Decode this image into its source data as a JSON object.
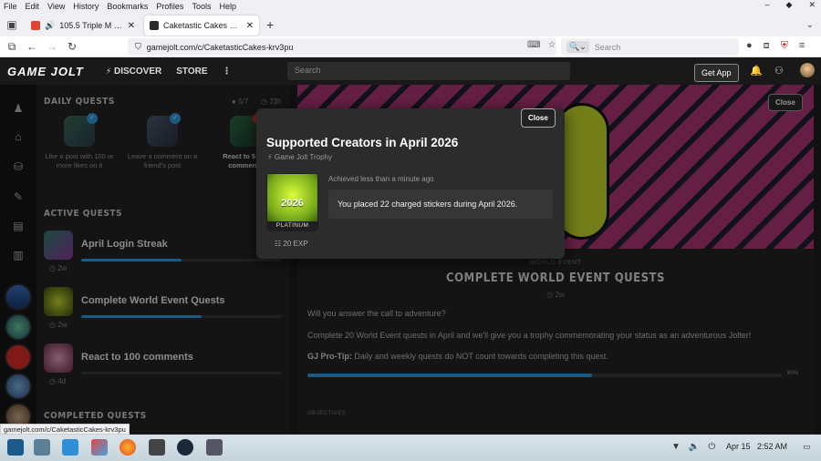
{
  "menu": [
    "File",
    "Edit",
    "View",
    "History",
    "Bookmarks",
    "Profiles",
    "Tools",
    "Help"
  ],
  "window_controls": [
    "–",
    "◆",
    "✕"
  ],
  "tabs": [
    {
      "title": "105.5 Triple M - The Sc",
      "close": "✕"
    },
    {
      "title": "Caketastic Cakes Commu",
      "close": "✕"
    }
  ],
  "new_tab": "+",
  "address": {
    "url": "gamejolt.com/c/CaketasticCakes-krv3pu"
  },
  "search": {
    "placeholder": "Search"
  },
  "site": {
    "logo": "GAME JOLT",
    "nav": [
      "DISCOVER",
      "STORE"
    ],
    "search_placeholder": "Search",
    "get_app": "Get App"
  },
  "quests": {
    "daily_title": "DAILY QUESTS",
    "daily_progress": "5/7",
    "daily_timer": "23h",
    "daily": [
      {
        "label": "Like a post with 100 or more likes on it"
      },
      {
        "label": "Leave a comment on a friend's post"
      },
      {
        "label": "React to 5 diff comments"
      }
    ],
    "active_title": "ACTIVE QUESTS",
    "active": [
      {
        "name": "April Login Streak",
        "time": "2w",
        "progress": 0.5
      },
      {
        "name": "Complete World Event Quests",
        "time": "2w",
        "progress": 0.6
      },
      {
        "name": "React to 100 comments",
        "time": "4d",
        "progress": 0.0
      }
    ],
    "completed_title": "COMPLETED QUESTS"
  },
  "world_event": {
    "kicker": "WORLD EVENT",
    "title": "COMPLETE WORLD EVENT QUESTS",
    "time": "2w",
    "q": "Will you answer the call to adventure?",
    "body": "Complete 20 World Event quests in April and we'll give you a trophy commemorating your status as an adventurous Jolter!",
    "tip_label": "GJ Pro-Tip:",
    "tip": "Daily and weekly quests do NOT count towards completing this quest.",
    "progress": 0.6,
    "pct_label": "60%",
    "objectives": "OBJECTIVES",
    "close": "Close"
  },
  "modal": {
    "close": "Close",
    "title": "Supported Creators in April 2026",
    "subtitle": "Game Jolt Trophy",
    "trophy_year": "2026",
    "trophy_tier": "PLATINUM",
    "exp": "20 EXP",
    "achieved": "Achieved less than a minute ago",
    "description": "You placed 22 charged stickers during April 2026."
  },
  "status_url": "gamejolt.com/c/CaketasticCakes-krv3pu",
  "taskbar": {
    "date": "Apr 15",
    "time": "2:52 AM"
  },
  "colors": {
    "accent": "#2f9be0",
    "site_bg": "#191919",
    "trophy_green": "#c8f02a"
  }
}
